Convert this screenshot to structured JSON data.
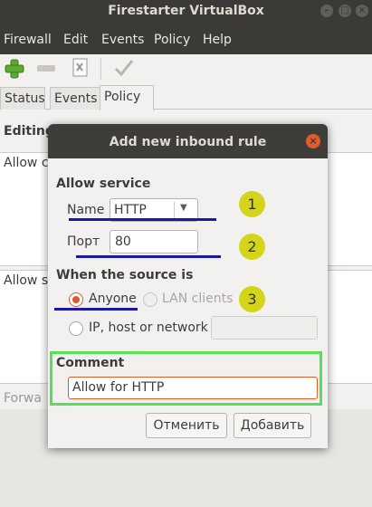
{
  "window": {
    "title": "Firestarter VirtualBox"
  },
  "menu": [
    "Firewall",
    "Edit",
    "Events",
    "Policy",
    "Help"
  ],
  "tabs": [
    "Status",
    "Events",
    "Policy"
  ],
  "background": {
    "editing_label": "Editing",
    "allow_c": "Allow c",
    "allow_s": "Allow s",
    "forward": "Forwa"
  },
  "dialog": {
    "title": "Add new inbound rule",
    "allow_service": "Allow service",
    "name_label": "Name",
    "name_value": "HTTP",
    "port_label": "Порт",
    "port_value": "80",
    "source_heading": "When the source is",
    "radio_anyone": "Anyone",
    "radio_lan": "LAN clients",
    "radio_ip": "IP, host or network",
    "comment_label": "Comment",
    "comment_value": "Allow for HTTP",
    "cancel": "Отменить",
    "add": "Добавить"
  },
  "annotations": {
    "badge1": "1",
    "badge2": "2",
    "badge3": "3"
  },
  "colors": {
    "accent": "#e05a2b",
    "annotation_line": "#1a1aa8",
    "badge": "#d4d41a",
    "highlight": "#55e055"
  }
}
